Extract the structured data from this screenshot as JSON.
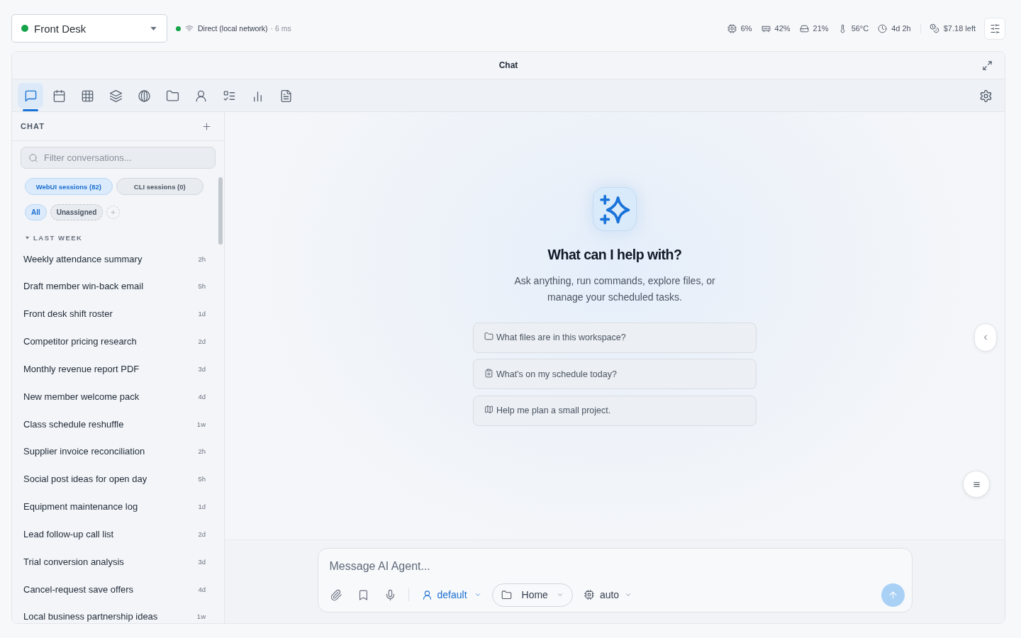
{
  "agent_selector": {
    "name": "Front Desk",
    "online": true
  },
  "connection": {
    "connected": true,
    "label": "Direct (local network)",
    "latency": "· 6 ms"
  },
  "system_stats": [
    {
      "kind": "cpu",
      "value": "6%"
    },
    {
      "kind": "memory",
      "value": "42%"
    },
    {
      "kind": "disk",
      "value": "21%"
    },
    {
      "kind": "temperature",
      "value": "56°C"
    },
    {
      "kind": "uptime",
      "value": "4d 2h"
    }
  ],
  "budget": {
    "value": "$7.18 left"
  },
  "panel": {
    "title": "Chat"
  },
  "tabs": [
    {
      "kind": "chat",
      "selected": true
    },
    {
      "kind": "calendar",
      "selected": false
    },
    {
      "kind": "table",
      "selected": false
    },
    {
      "kind": "layers",
      "selected": false
    },
    {
      "kind": "globe",
      "selected": false
    },
    {
      "kind": "files",
      "selected": false
    },
    {
      "kind": "profile",
      "selected": false
    },
    {
      "kind": "tasks",
      "selected": false
    },
    {
      "kind": "stats",
      "selected": false
    },
    {
      "kind": "document",
      "selected": false
    }
  ],
  "sidebar": {
    "title": "CHAT",
    "search": {
      "placeholder": "Filter conversations..."
    },
    "source_filters": [
      {
        "label": "WebUI sessions (82)",
        "selected": true
      },
      {
        "label": "CLI sessions (0)",
        "selected": false
      }
    ],
    "groups": [
      {
        "label": "All",
        "selected": true
      },
      {
        "label": "Unassigned",
        "selected": false
      }
    ],
    "section": {
      "label": "LAST WEEK",
      "expanded": true
    },
    "conversations": [
      {
        "title": "Weekly attendance summary",
        "age": "2h"
      },
      {
        "title": "Draft member win-back email",
        "age": "5h"
      },
      {
        "title": "Front desk shift roster",
        "age": "1d"
      },
      {
        "title": "Competitor pricing research",
        "age": "2d"
      },
      {
        "title": "Monthly revenue report PDF",
        "age": "3d"
      },
      {
        "title": "New member welcome pack",
        "age": "4d"
      },
      {
        "title": "Class schedule reshuffle",
        "age": "1w"
      },
      {
        "title": "Supplier invoice reconciliation",
        "age": "2h"
      },
      {
        "title": "Social post ideas for open day",
        "age": "5h"
      },
      {
        "title": "Equipment maintenance log",
        "age": "1d"
      },
      {
        "title": "Lead follow-up call list",
        "age": "2d"
      },
      {
        "title": "Trial conversion analysis",
        "age": "3d"
      },
      {
        "title": "Cancel-request save offers",
        "age": "4d"
      },
      {
        "title": "Local business partnership ideas",
        "age": "1w"
      }
    ]
  },
  "welcome": {
    "title": "What can I help with?",
    "subtitle": "Ask anything, run commands, explore files, or manage your scheduled tasks."
  },
  "suggestions": [
    {
      "kind": "folder",
      "text": "What files are in this workspace?"
    },
    {
      "kind": "clipboard",
      "text": "What's on my schedule today?"
    },
    {
      "kind": "map",
      "text": "Help me plan a small project."
    }
  ],
  "composer": {
    "placeholder": "Message AI Agent...",
    "profile": "default",
    "folder": "Home",
    "model": "auto"
  }
}
